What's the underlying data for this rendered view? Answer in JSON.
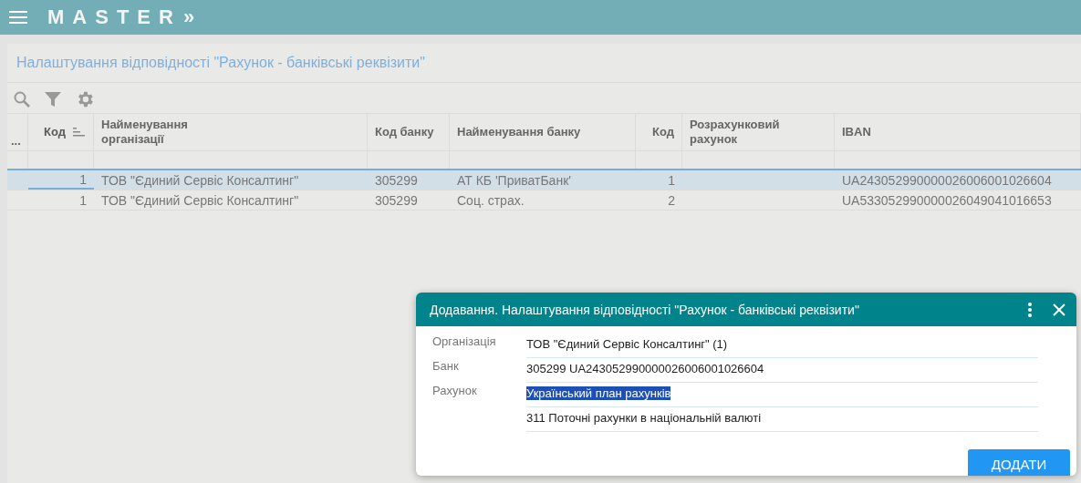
{
  "app_bar": {
    "logo": "MASTER",
    "chevron": "»"
  },
  "page": {
    "title": "Налаштування відповідності \"Рахунок - банківські реквізити\""
  },
  "table": {
    "columns": [
      {
        "label": "...",
        "sorted": false
      },
      {
        "label": "Код",
        "sorted": true
      },
      {
        "label": "Найменування організації",
        "sorted": false
      },
      {
        "label": "Код банку",
        "sorted": false
      },
      {
        "label": "Найменування банку",
        "sorted": false
      },
      {
        "label": "Код",
        "sorted": false
      },
      {
        "label": "Розрахунковий рахунок",
        "sorted": false
      },
      {
        "label": "IBAN",
        "sorted": false
      }
    ],
    "rows": [
      {
        "selected": true,
        "cells": [
          "",
          "1",
          "ТОВ \"Єдиний Сервіс Консалтинг\"",
          "305299",
          "АТ КБ 'ПриватБанк'",
          "1",
          "",
          "UA243052990000026006001026604"
        ]
      },
      {
        "selected": false,
        "cells": [
          "",
          "1",
          "ТОВ \"Єдиний Сервіс Консалтинг\"",
          "305299",
          "Соц. страх.",
          "2",
          "",
          "UA533052990000026049041016653"
        ]
      }
    ]
  },
  "dialog": {
    "title": "Додавання. Налаштування відповідності \"Рахунок - банківські реквізити\"",
    "fields": [
      {
        "label": "Організація",
        "value": "ТОВ \"Єдиний Сервіс Консалтинг\" (1)",
        "highlighted": false
      },
      {
        "label": "Банк",
        "value": "305299  UA243052990000026006001026604",
        "highlighted": false
      },
      {
        "label": "Рахунок",
        "value": "Український план рахунків",
        "highlighted": true
      },
      {
        "value": "311 Поточні рахунки в національній валюті",
        "highlighted": false
      }
    ],
    "button": "ДОДАТИ"
  }
}
